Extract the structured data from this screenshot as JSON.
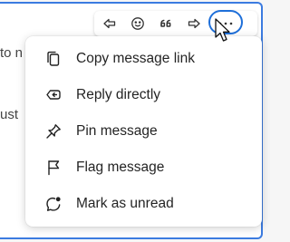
{
  "background": {
    "text_fragments": [
      "to n",
      "ust"
    ]
  },
  "toolbar": {
    "buttons": [
      {
        "icon": "reply-icon"
      },
      {
        "icon": "emoji-icon"
      },
      {
        "icon": "quote-icon"
      },
      {
        "icon": "forward-icon"
      },
      {
        "icon": "more-options-icon",
        "state": "hovered"
      }
    ]
  },
  "context_menu": {
    "items": [
      {
        "label": "Copy message link",
        "icon": "copy-link-icon"
      },
      {
        "label": "Reply directly",
        "icon": "reply-directly-icon"
      },
      {
        "label": "Pin message",
        "icon": "pin-icon"
      },
      {
        "label": "Flag message",
        "icon": "flag-icon"
      },
      {
        "label": "Mark as unread",
        "icon": "mark-unread-icon"
      }
    ]
  },
  "colors": {
    "accent": "#1e6fd9",
    "menu_background": "#ffffff",
    "text": "#242424"
  }
}
